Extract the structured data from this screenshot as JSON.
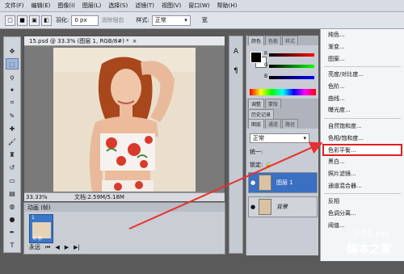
{
  "menubar": [
    "文件(F)",
    "编辑(E)",
    "图像(I)",
    "图层(L)",
    "选择(S)",
    "滤镜(T)",
    "视图(V)",
    "窗口(W)",
    "帮助(H)"
  ],
  "options": {
    "feather_label": "羽化:",
    "feather_value": "0 px",
    "antialias_label": "消除锯齿",
    "style_label": "样式:",
    "style_value": "正常",
    "width_label": "宽"
  },
  "document": {
    "tab_title": "15.psd @ 33.3% (图层 1, RGB/8#) *",
    "zoom": "33.33%",
    "doc_size": "文档:2.59M/5.18M"
  },
  "animation": {
    "title": "动画 (帧)",
    "frame_number": "1",
    "frame_time": "0 秒",
    "loop": "永远"
  },
  "color_panel": {
    "tabs": [
      "颜色",
      "色板",
      "样式"
    ],
    "channels": [
      "R",
      "G",
      "B"
    ],
    "values": [
      "",
      "",
      ""
    ]
  },
  "adjust_tabs": [
    "调整",
    "蒙版"
  ],
  "history_tab": "历史记录",
  "layers_panel": {
    "tabs": [
      "图层",
      "通道",
      "路径"
    ],
    "blend_mode": "正常",
    "lock_label": "锁定:",
    "unify_label": "统一:",
    "layers": [
      {
        "name": "图层 1",
        "selected": true
      },
      {
        "name": "背景",
        "selected": false
      }
    ]
  },
  "adjust_menu": {
    "groups": [
      [
        "纯色...",
        "渐变...",
        "图案..."
      ],
      [
        "亮度/对比度...",
        "色阶...",
        "曲线...",
        "曝光度..."
      ],
      [
        "自然饱和度...",
        "色相/饱和度...",
        "色彩平衡...",
        "黑白...",
        "照片滤镜...",
        "通道混合器..."
      ],
      [
        "反相",
        "色调分离...",
        "阈值..."
      ]
    ],
    "highlighted": "色彩平衡..."
  },
  "watermark": {
    "site": "jb51.net",
    "name": "脚本之家"
  }
}
